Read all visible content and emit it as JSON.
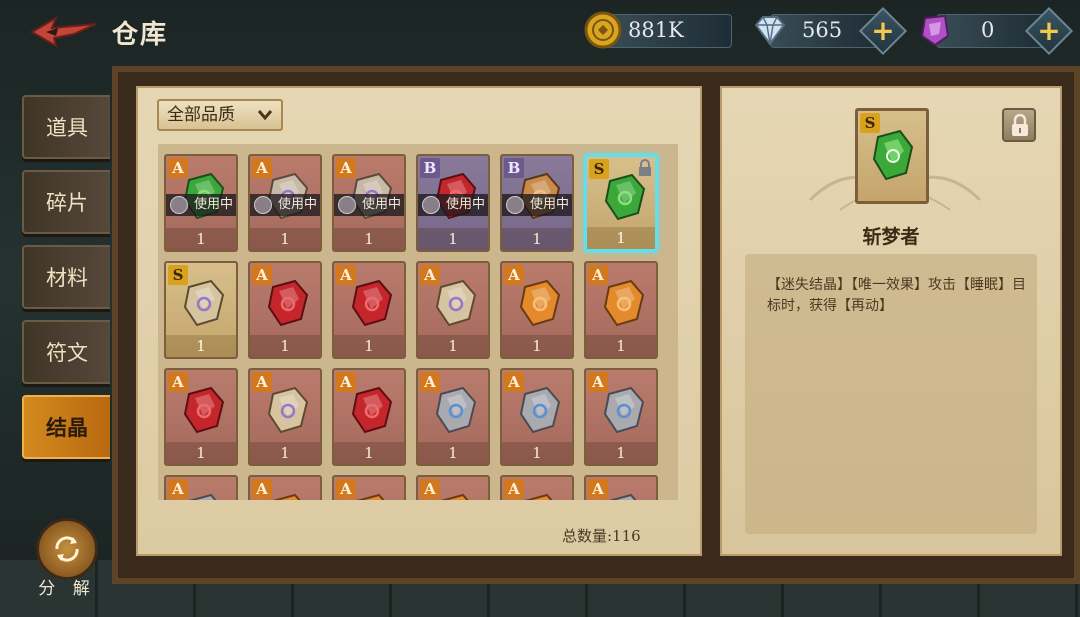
{
  "header": {
    "title": "仓库",
    "currencies": [
      {
        "icon": "gold-coin-icon",
        "value": "881K",
        "has_plus": false
      },
      {
        "icon": "diamond-icon",
        "value": "565",
        "has_plus": true
      },
      {
        "icon": "purple-crystal-icon",
        "value": "0",
        "has_plus": true
      }
    ]
  },
  "tabs": [
    {
      "label": "道具",
      "active": false
    },
    {
      "label": "碎片",
      "active": false
    },
    {
      "label": "材料",
      "active": false
    },
    {
      "label": "符文",
      "active": false
    },
    {
      "label": "结晶",
      "active": true
    }
  ],
  "decompose_label": "分 解",
  "filter": {
    "selected": "全部品质"
  },
  "inventory": {
    "in_use_label": "使用中",
    "items": [
      {
        "grade": "A",
        "gem": "green",
        "qty": "1",
        "in_use": true
      },
      {
        "grade": "A",
        "gem": "purple",
        "qty": "1",
        "in_use": true
      },
      {
        "grade": "A",
        "gem": "purple",
        "qty": "1",
        "in_use": true
      },
      {
        "grade": "B",
        "gem": "red",
        "qty": "1",
        "in_use": true
      },
      {
        "grade": "B",
        "gem": "amber",
        "qty": "1",
        "in_use": true
      },
      {
        "grade": "S",
        "gem": "green",
        "qty": "1",
        "in_use": false,
        "selected": true,
        "locked": true
      },
      {
        "grade": "S",
        "gem": "tan",
        "qty": "1",
        "in_use": false
      },
      {
        "grade": "A",
        "gem": "red",
        "qty": "1",
        "in_use": false
      },
      {
        "grade": "A",
        "gem": "red",
        "qty": "1",
        "in_use": false
      },
      {
        "grade": "A",
        "gem": "tan",
        "qty": "1",
        "in_use": false
      },
      {
        "grade": "A",
        "gem": "orange",
        "qty": "1",
        "in_use": false
      },
      {
        "grade": "A",
        "gem": "orange",
        "qty": "1",
        "in_use": false
      },
      {
        "grade": "A",
        "gem": "red",
        "qty": "1",
        "in_use": false
      },
      {
        "grade": "A",
        "gem": "tan",
        "qty": "1",
        "in_use": false
      },
      {
        "grade": "A",
        "gem": "red",
        "qty": "1",
        "in_use": false
      },
      {
        "grade": "A",
        "gem": "grey",
        "qty": "1",
        "in_use": false
      },
      {
        "grade": "A",
        "gem": "grey",
        "qty": "1",
        "in_use": false
      },
      {
        "grade": "A",
        "gem": "grey",
        "qty": "1",
        "in_use": false
      },
      {
        "grade": "A",
        "gem": "grey",
        "qty": "",
        "in_use": false
      },
      {
        "grade": "A",
        "gem": "orange",
        "qty": "",
        "in_use": false
      },
      {
        "grade": "A",
        "gem": "orange",
        "qty": "",
        "in_use": false
      },
      {
        "grade": "A",
        "gem": "orange",
        "qty": "",
        "in_use": false
      },
      {
        "grade": "A",
        "gem": "orange",
        "qty": "",
        "in_use": false
      },
      {
        "grade": "A",
        "gem": "grey",
        "qty": "",
        "in_use": false
      }
    ],
    "total_label": "总数量:116"
  },
  "detail": {
    "grade": "S",
    "gem": "green",
    "name": "斩梦者",
    "description": "【迷失结晶】【唯一效果】攻击【睡眠】目标时，获得【再动】",
    "lock_icon": "padlock-icon"
  },
  "colors": {
    "accent_tab": "#d38a1f",
    "selected_border": "#5fe0f0",
    "gold_plus": "#f2c94c"
  }
}
